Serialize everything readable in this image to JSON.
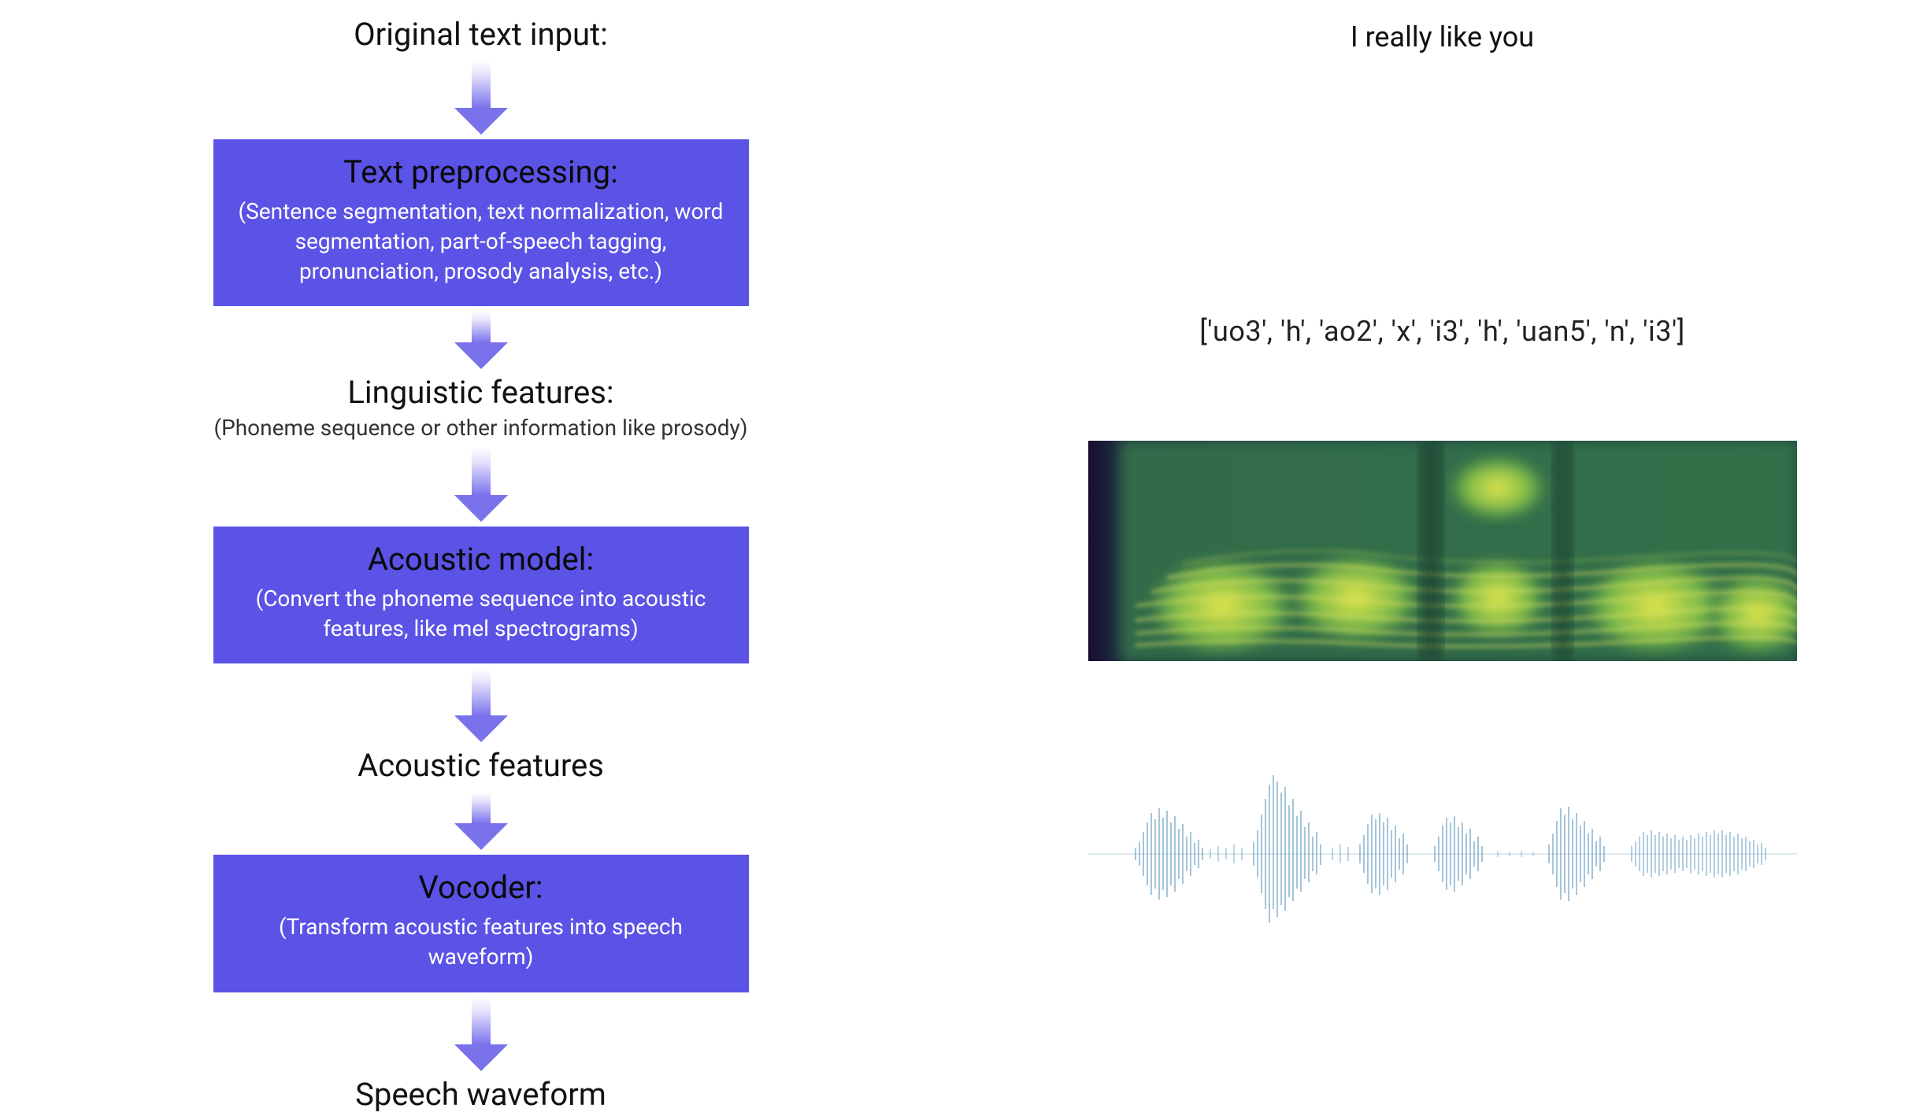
{
  "flow": {
    "input_label": "Original text input:",
    "text_preprocessing": {
      "title": "Text preprocessing:",
      "desc": "(Sentence segmentation, text normalization, word segmentation, part-of-speech tagging, pronunciation, prosody analysis, etc.)"
    },
    "linguistic": {
      "title": "Linguistic features:",
      "sub": "(Phoneme sequence or other information like prosody)"
    },
    "acoustic_model": {
      "title": "Acoustic model:",
      "desc": "(Convert the phoneme sequence into acoustic features, like mel spectrograms)"
    },
    "acoustic_features_label": "Acoustic features",
    "vocoder": {
      "title": "Vocoder:",
      "desc": "(Transform acoustic features into speech waveform)"
    },
    "output_label": "Speech waveform"
  },
  "example": {
    "input_text": "I really like you",
    "phoneme_sequence": "['uo3', 'h', 'ao2', 'x', 'i3', 'h', 'uan5', 'n', 'i3']"
  },
  "colors": {
    "box_bg": "#5b52e6",
    "arrow": "#7a72ea",
    "waveform": "#4a8bb5"
  }
}
